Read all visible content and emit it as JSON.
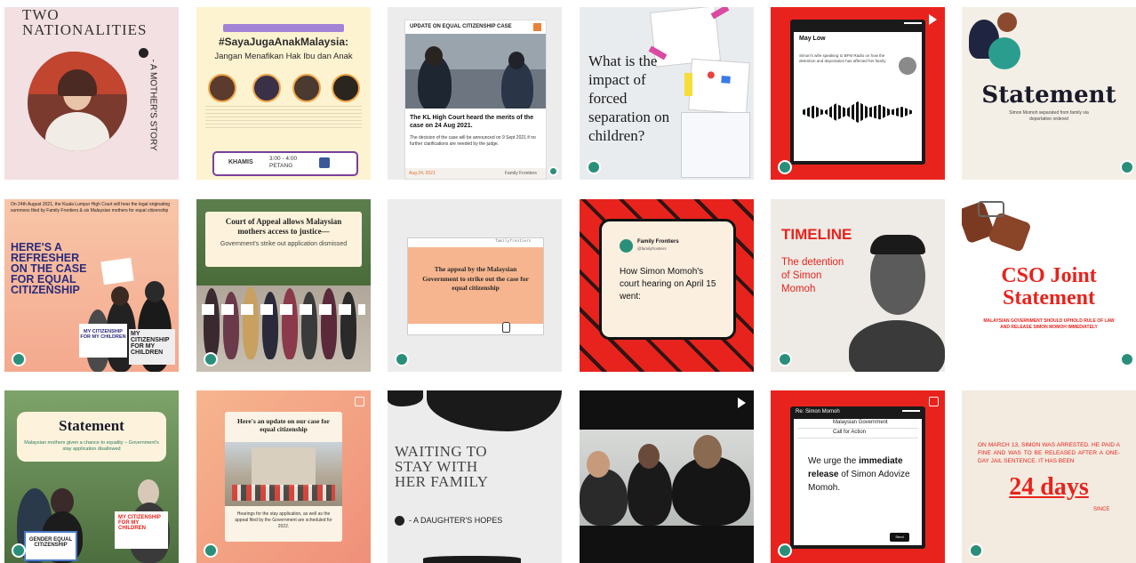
{
  "tiles": {
    "t1": {
      "title": "TWO\nNATIONALITIES",
      "side": "- A MOTHER'S STORY"
    },
    "t2": {
      "badge": "",
      "hashtag": "#SayaJugaAnakMalaysia:",
      "subtitle": "Jangan Menafikan Hak Ibu dan Anak",
      "footer_date": "KHAMIS",
      "footer_time": "3:00 - 4:00 PETANG"
    },
    "t3": {
      "header": "UPDATE ON EQUAL CITIZENSHIP CASE",
      "headline": "The KL High Court heard the merits of the case on 24 Aug 2021.",
      "body": "The decision of the case will be announced on 9 Sept 2021 if no further clarifications are needed by the judge.",
      "date": "Aug 24, 2021",
      "source": "Family Frontiers"
    },
    "t4": {
      "question": "What is the impact of forced separation on children?"
    },
    "t5": {
      "name": "May Low",
      "msg": "Simon's wife speaking to BFM Radio on how the detention and deportation has affected her family"
    },
    "t6": {
      "title": "Statement",
      "sub": "Simon Momoh separated from family via deportation ordered"
    },
    "t7": {
      "intro": "On 24th August 2021, the Kuala Lumpur High Court will hear the legal originating summons filed by Family Frontiers & six Malaysian mothers for equal citizenship",
      "title": "HERE'S A REFRESHER ON THE CASE FOR EQUAL CITIZENSHIP",
      "sign1": "MY CITIZENSHIP FOR MY CHILDREN",
      "sign2": "MY CITIZENSHIP FOR MY CHILDREN"
    },
    "t8": {
      "title": "Court of Appeal allows Malaysian mothers access to justice—",
      "sub": "Government's strike out application dismissed"
    },
    "t9": {
      "window_title": "familyfrontiers",
      "text": "The appeal by the Malaysian Government to strike out the case for equal citizenship"
    },
    "t10": {
      "account": "Family Frontiers",
      "handle": "@familyfrontiers",
      "tweet": "How Simon Momoh's court hearing on April 15 went:"
    },
    "t11": {
      "title": "TIMELINE",
      "sub": "The detention of Simon Momoh"
    },
    "t12": {
      "title": "CSO Joint Statement",
      "sub": "MALAYSIAN GOVERNMENT SHOULD UPHOLD RULE OF LAW AND RELEASE SIMON MOMOH IMMEDIATELY"
    },
    "t13": {
      "title": "Statement",
      "sub": "Malaysian mothers given a chance to equality – Government's stay application disallowed",
      "sign": "GENDER EQUAL CITIZENSHIP",
      "sign2": "MY CITIZENSHIP FOR MY CHILDREN"
    },
    "t14": {
      "title": "Here's an update on our case for equal citizenship",
      "body": "Hearings for the stay application, as well as the appeal filed by the Government are scheduled for 2022."
    },
    "t15": {
      "title": "WAITING TO STAY WITH HER FAMILY",
      "sub": "- A DAUGHTER'S HOPES"
    },
    "t17": {
      "subject_label": "Re: Simon Momoh",
      "to": "Malaysian Government",
      "subject": "Call for Action",
      "body_pre": "We urge the ",
      "body_bold": "immediate release",
      "body_post": " of Simon Adovize Momoh.",
      "send": "Send"
    },
    "t18": {
      "line1": "ON MARCH 13, SIMON WAS ARRESTED. HE PAID A FINE AND WAS TO BE RELEASED AFTER A ONE-DAY JAIL SENTENCE. IT HAS BEEN",
      "big": "24 days",
      "since": "SINCE"
    }
  },
  "colors": {
    "brand": "#2a8f7a",
    "red": "#e8231d",
    "peach": "#f6b58e"
  }
}
